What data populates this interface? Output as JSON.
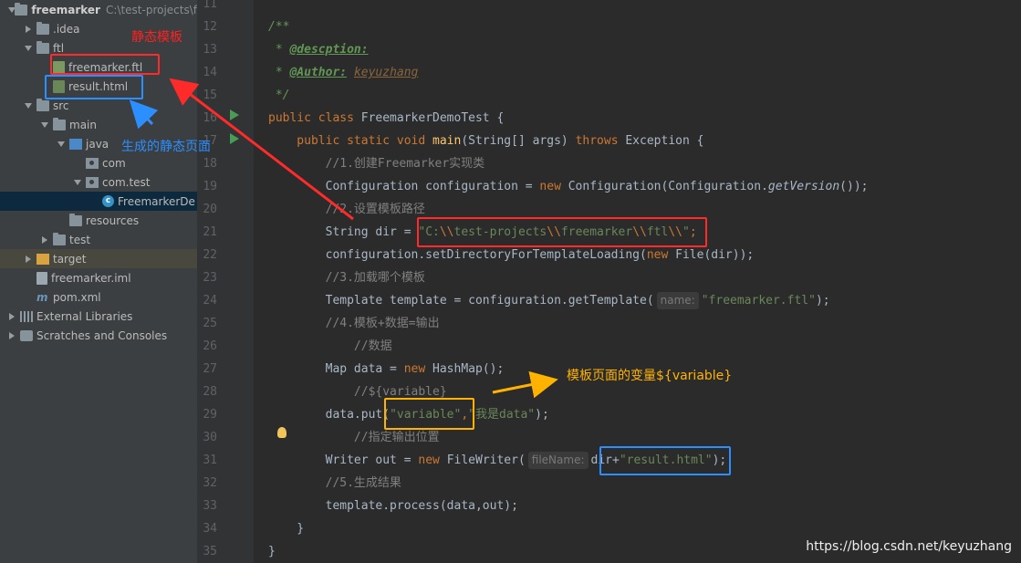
{
  "project_tree": [
    {
      "label": "freemarker",
      "sub": "C:\\test-projects\\f",
      "indent": 0,
      "arrow": "down",
      "icon": "folder",
      "icon_name": "project-folder-icon",
      "bold": true
    },
    {
      "label": ".idea",
      "indent": 1,
      "arrow": "right",
      "icon": "folder",
      "icon_name": "folder-icon"
    },
    {
      "label": "ftl",
      "indent": 1,
      "arrow": "down",
      "icon": "folder",
      "icon_name": "folder-icon"
    },
    {
      "label": "freemarker.ftl",
      "indent": 2,
      "arrow": "none",
      "icon": "file-ftl",
      "icon_name": "ftl-file-icon"
    },
    {
      "label": "result.html",
      "indent": 2,
      "arrow": "none",
      "icon": "file-html",
      "icon_name": "html-file-icon"
    },
    {
      "label": "src",
      "indent": 1,
      "arrow": "down",
      "icon": "folder",
      "icon_name": "folder-icon"
    },
    {
      "label": "main",
      "indent": 2,
      "arrow": "down",
      "icon": "folder",
      "icon_name": "folder-icon"
    },
    {
      "label": "java",
      "indent": 3,
      "arrow": "down",
      "icon": "folder-blue",
      "icon_name": "source-folder-icon"
    },
    {
      "label": "com",
      "indent": 4,
      "arrow": "none",
      "icon": "package",
      "icon_name": "package-icon"
    },
    {
      "label": "com.test",
      "indent": 4,
      "arrow": "down",
      "icon": "package",
      "icon_name": "package-icon"
    },
    {
      "label": "FreemarkerDe",
      "indent": 5,
      "arrow": "none",
      "icon": "class",
      "icon_name": "java-class-icon",
      "selected": true
    },
    {
      "label": "resources",
      "indent": 3,
      "arrow": "none",
      "icon": "folder",
      "icon_name": "resources-folder-icon"
    },
    {
      "label": "test",
      "indent": 2,
      "arrow": "right",
      "icon": "folder",
      "icon_name": "folder-icon"
    },
    {
      "label": "target",
      "indent": 1,
      "arrow": "right",
      "icon": "folder-orange",
      "icon_name": "excluded-folder-icon",
      "highlight": true
    },
    {
      "label": "freemarker.iml",
      "indent": 1,
      "arrow": "none",
      "icon": "file-iml",
      "icon_name": "iml-file-icon"
    },
    {
      "label": "pom.xml",
      "indent": 1,
      "arrow": "none",
      "icon": "maven",
      "icon_name": "maven-icon"
    },
    {
      "label": "External Libraries",
      "indent": 0,
      "arrow": "right",
      "icon": "libs",
      "icon_name": "libraries-icon"
    },
    {
      "label": "Scratches and Consoles",
      "indent": 0,
      "arrow": "right",
      "icon": "scratch",
      "icon_name": "scratches-icon"
    }
  ],
  "line_numbers": [
    "11",
    "12",
    "13",
    "14",
    "15",
    "16",
    "17",
    "18",
    "19",
    "20",
    "21",
    "22",
    "23",
    "24",
    "25",
    "26",
    "27",
    "28",
    "29",
    "30",
    "31",
    "32",
    "33",
    "34",
    "35"
  ],
  "code": {
    "l12": "/**",
    "l13_star": " * ",
    "l13_tag": "@descption:",
    "l14_star": " * ",
    "l14_tag": "@Author:",
    "l14_val": "keyuzhang",
    "l15": " */",
    "l16_kw": "public class ",
    "l16_rest": "FreemarkerDemoTest {",
    "l17_kw": "    public static void ",
    "l17_fn": "main",
    "l17_a": "(String[] args) ",
    "l17_kw2": "throws ",
    "l17_b": "Exception {",
    "l18": "        //1.创建Freemarker实现类",
    "l19_a": "        Configuration configuration = ",
    "l19_kw": "new ",
    "l19_b": "Configuration(Configuration.",
    "l19_it": "getVersion",
    "l19_c": "());",
    "l20": "        //2.设置模板路径",
    "l21_a": "        String dir = ",
    "l21_str_a": "\"C:",
    "l21_e1": "\\\\",
    "l21_str_b": "test-projects",
    "l21_e2": "\\\\",
    "l21_str_c": "freemarker",
    "l21_e3": "\\\\",
    "l21_str_d": "ftl",
    "l21_e4": "\\\\",
    "l21_str_e": "\"",
    "l21_semi": ";",
    "l22_a": "        configuration.setDirectoryForTemplateLoading(",
    "l22_kw": "new ",
    "l22_b": "File(dir));",
    "l23": "        //3.加载哪个模板",
    "l24_a": "        Template template = configuration.getTemplate(",
    "l24_hint": "name:",
    "l24_str": "\"freemarker.ftl\"",
    "l24_b": ");",
    "l25": "        //4.模板+数据=输出",
    "l26": "            //数据",
    "l27_a": "        Map data = ",
    "l27_kw": "new ",
    "l27_b": "HashMap();",
    "l28": "            //${variable}",
    "l29_a": "        data.put(",
    "l29_str1": "\"variable\"",
    "l29_comma": ",",
    "l29_str2": "\"我是data\"",
    "l29_b": ");",
    "l30": "            //指定输出位置",
    "l31_a": "        Writer out = ",
    "l31_kw": "new ",
    "l31_b": "FileWriter(",
    "l31_hint": "fileName:",
    "l31_c": "dir+",
    "l31_str": "\"result.html\"",
    "l31_d": ");",
    "l32": "        //5.生成结果",
    "l33": "        template.process(data,out);",
    "l34": "    }",
    "l35": "}"
  },
  "annotations": {
    "static_template": "静态模板",
    "generated_page": "生成的静态页面",
    "template_variable": "模板页面的变量${variable}",
    "colors": {
      "red": "#ff2a2a",
      "blue": "#2b8fff",
      "yellow": "#ffb300"
    }
  },
  "watermark": "https://blog.csdn.net/keyuzhang"
}
